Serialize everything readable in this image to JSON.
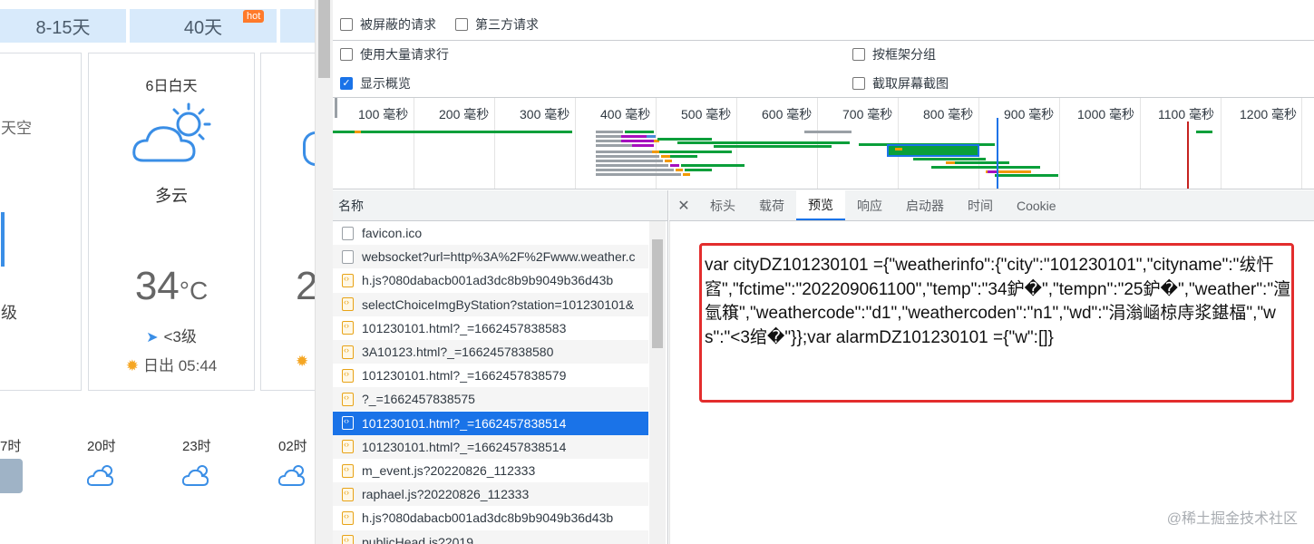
{
  "weather": {
    "tabs": [
      {
        "label": "8-15天"
      },
      {
        "label": "40天",
        "badge": "hot"
      }
    ],
    "partial_left": {
      "sky_text": "天空",
      "level_text": "级"
    },
    "card": {
      "date": "6日白天",
      "condition": "多云",
      "temp": "34",
      "unit": "°C",
      "wind": "<3级",
      "sunrise": "日出 05:44"
    },
    "partial_card_digit": "2",
    "hours": [
      "7时",
      "20时",
      "23时",
      "02时"
    ],
    "colors": {
      "tab_bg": "#d8eafb",
      "icon": "#3a8ee6",
      "sun": "#f5a623"
    }
  },
  "devtools": {
    "filters": {
      "blocked_requests": "被屏蔽的请求",
      "third_party": "第三方请求",
      "large_rows": "使用大量请求行",
      "group_by_frame": "按框架分组",
      "show_overview": "显示概览",
      "capture_screenshots": "截取屏幕截图"
    },
    "timeline_labels": [
      "100 毫秒",
      "200 毫秒",
      "300 毫秒",
      "400 毫秒",
      "500 毫秒",
      "600 毫秒",
      "700 毫秒",
      "800 毫秒",
      "900 毫秒",
      "1000 毫秒",
      "1100 毫秒",
      "1200 毫秒"
    ],
    "list_header": "名称",
    "requests": [
      {
        "name": "favicon.ico",
        "type": "file"
      },
      {
        "name": "websocket?url=http%3A%2F%2Fwww.weather.c",
        "type": "file"
      },
      {
        "name": "h.js?080dabacb001ad3dc8b9b9049b36d43b",
        "type": "script"
      },
      {
        "name": "selectChoiceImgByStation?station=101230101&",
        "type": "script"
      },
      {
        "name": "101230101.html?_=1662457838583",
        "type": "script"
      },
      {
        "name": "3A10123.html?_=1662457838580",
        "type": "script"
      },
      {
        "name": "101230101.html?_=1662457838579",
        "type": "script"
      },
      {
        "name": "?_=1662457838575",
        "type": "script"
      },
      {
        "name": "101230101.html?_=1662457838514",
        "type": "doc",
        "selected": true
      },
      {
        "name": "101230101.html?_=1662457838514",
        "type": "script"
      },
      {
        "name": "m_event.js?20220826_112333",
        "type": "script"
      },
      {
        "name": "raphael.js?20220826_112333",
        "type": "script"
      },
      {
        "name": "h.js?080dabacb001ad3dc8b9b9049b36d43b",
        "type": "script"
      },
      {
        "name": "publicHead.js?2019",
        "type": "script"
      }
    ],
    "detail_tabs": [
      "标头",
      "载荷",
      "预览",
      "响应",
      "启动器",
      "时间",
      "Cookie"
    ],
    "active_tab": "预览",
    "preview_text": "var cityDZ101230101 ={\"weatherinfo\":{\"city\":\"101230101\",\"cityname\":\"绂忓窞\",\"fctime\":\"202209061100\",\"temp\":\"34鈩�\",\"tempn\":\"25鈩�\",\"weather\":\"澶氫簯\",\"weathercode\":\"d1\",\"weathercoden\":\"n1\",\"wd\":\"涓滃崡椋庤浆鍖楅\",\"ws\":\"<3绾�\"}};var alarmDZ101230101 ={\"w\":[]}",
    "highlight_color": "#e32d2d",
    "selected_color": "#1a73e8"
  },
  "watermark": "@稀土掘金技术社区"
}
